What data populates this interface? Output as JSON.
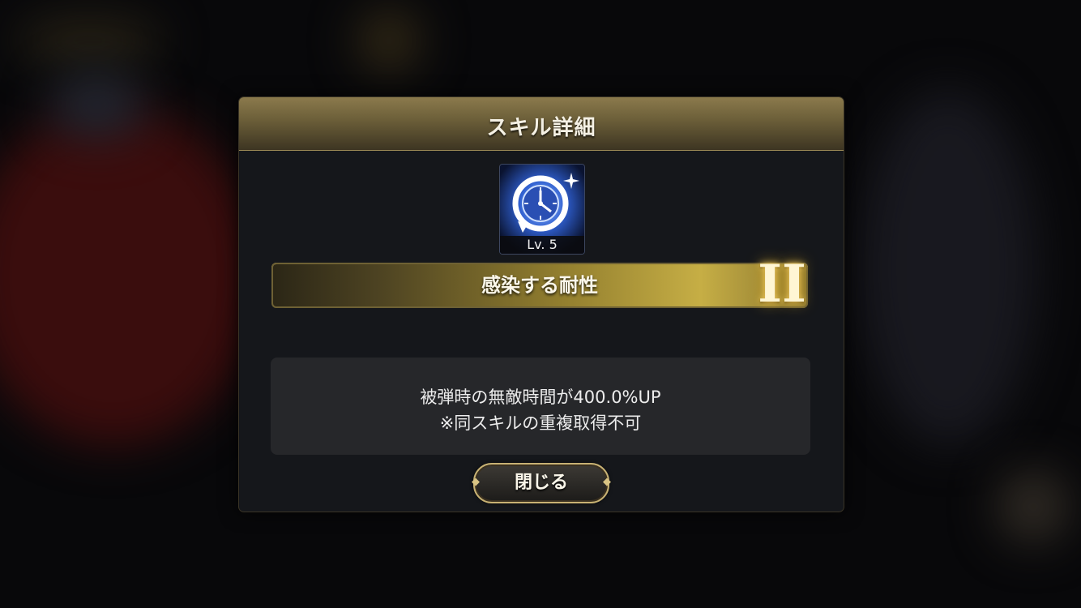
{
  "dialog": {
    "title": "スキル詳細",
    "skill": {
      "icon": "clock-icon",
      "level_label": "Lv. 5",
      "name": "感染する耐性",
      "rank": "II"
    },
    "description": {
      "line1": "被弾時の無敵時間が400.0%UP",
      "line2": "※同スキルの重複取得不可"
    },
    "close_label": "閉じる"
  },
  "colors": {
    "header_gold": "#8b7a4c",
    "bar_gold": "#c6ae45",
    "panel_bg": "#26272a",
    "modal_bg": "#15171b"
  }
}
